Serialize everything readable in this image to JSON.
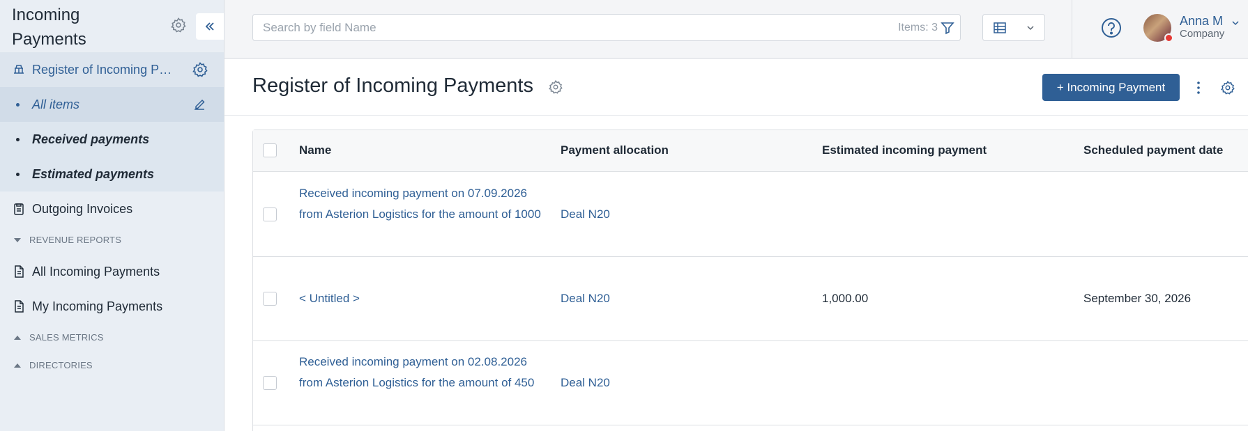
{
  "sidebar": {
    "title": "Incoming Payments",
    "register_label": "Register of Incoming Payments",
    "subitems": [
      {
        "label": "All items"
      },
      {
        "label": "Received payments"
      },
      {
        "label": "Estimated payments"
      }
    ],
    "outgoing_label": "Outgoing Invoices",
    "sections": {
      "revenue_reports": "REVENUE REPORTS",
      "sales_metrics": "SALES METRICS",
      "directories": "DIRECTORIES"
    },
    "reports": [
      {
        "label": "All Incoming Payments"
      },
      {
        "label": "My Incoming Payments"
      }
    ]
  },
  "topbar": {
    "search_placeholder": "Search by field Name",
    "items_count": "Items: 3",
    "user_name": "Anna M",
    "user_company": "Company"
  },
  "main": {
    "title": "Register of Incoming Payments",
    "add_button": "+ Incoming Payment",
    "columns": [
      "Name",
      "Payment allocation",
      "Estimated incoming payment",
      "Scheduled payment date"
    ],
    "rows": [
      {
        "name": "Received incoming payment on 07.09.2026 from Asterion Logistics for the amount of 1000",
        "allocation": "Deal N20",
        "estimated": "",
        "scheduled": ""
      },
      {
        "name": "< Untitled >",
        "allocation": "Deal N20",
        "estimated": "1,000.00",
        "scheduled": "September 30, 2026"
      },
      {
        "name": "Received incoming payment on 02.08.2026 from Asterion Logistics for the amount of 450",
        "allocation": "Deal N20",
        "estimated": "",
        "scheduled": ""
      }
    ]
  },
  "colors": {
    "accent": "#2f5f95",
    "sidebar_bg": "#e9eef4",
    "status_busy": "#e53935"
  },
  "icons": {
    "title_settings": "gear-icon",
    "collapse": "double-chevron-left-icon",
    "register": "register-icon",
    "edit": "pencil-icon",
    "invoices": "clipboard-icon",
    "report": "document-icon",
    "filter": "filter-icon",
    "view": "table-view-icon",
    "help": "question-circle-icon",
    "more": "kebab-icon"
  }
}
